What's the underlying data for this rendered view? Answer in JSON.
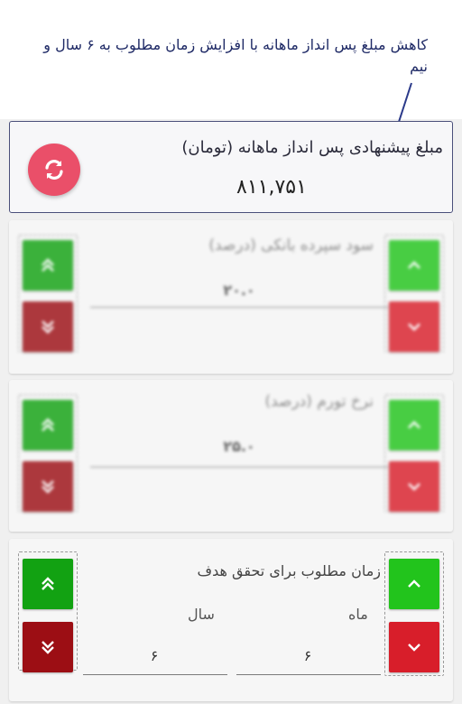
{
  "annotation": {
    "text": "کاهش مبلغ پس انداز ماهانه با افزایش زمان مطلوب به ۶ سال و نیم"
  },
  "result": {
    "title": "مبلغ پیشنهادی پس انداز ماهانه (تومان)",
    "value": "۸۱۱,۷۵۱"
  },
  "bank_interest": {
    "label": "سود سپرده بانکی (درصد)",
    "value": "۲۰.۰"
  },
  "inflation": {
    "label": "نرخ تورم (درصد)",
    "value": "۲۵.۰"
  },
  "time_required": {
    "title": "زمان مطلوب برای تحقق هدف",
    "month_label": "ماه",
    "year_label": "سال",
    "month_value": "۶",
    "year_value": "۶"
  },
  "colors": {
    "accent_refresh": "#ea4f69",
    "increase_green": "#22c41c",
    "decrease_red": "#d81e2a",
    "annotation_text": "#1f2a66"
  },
  "icons": {
    "refresh": "refresh-icon",
    "up": "chevron-up-icon",
    "down": "chevron-down-icon",
    "double_up": "double-chevron-up-icon",
    "double_down": "double-chevron-down-icon"
  }
}
